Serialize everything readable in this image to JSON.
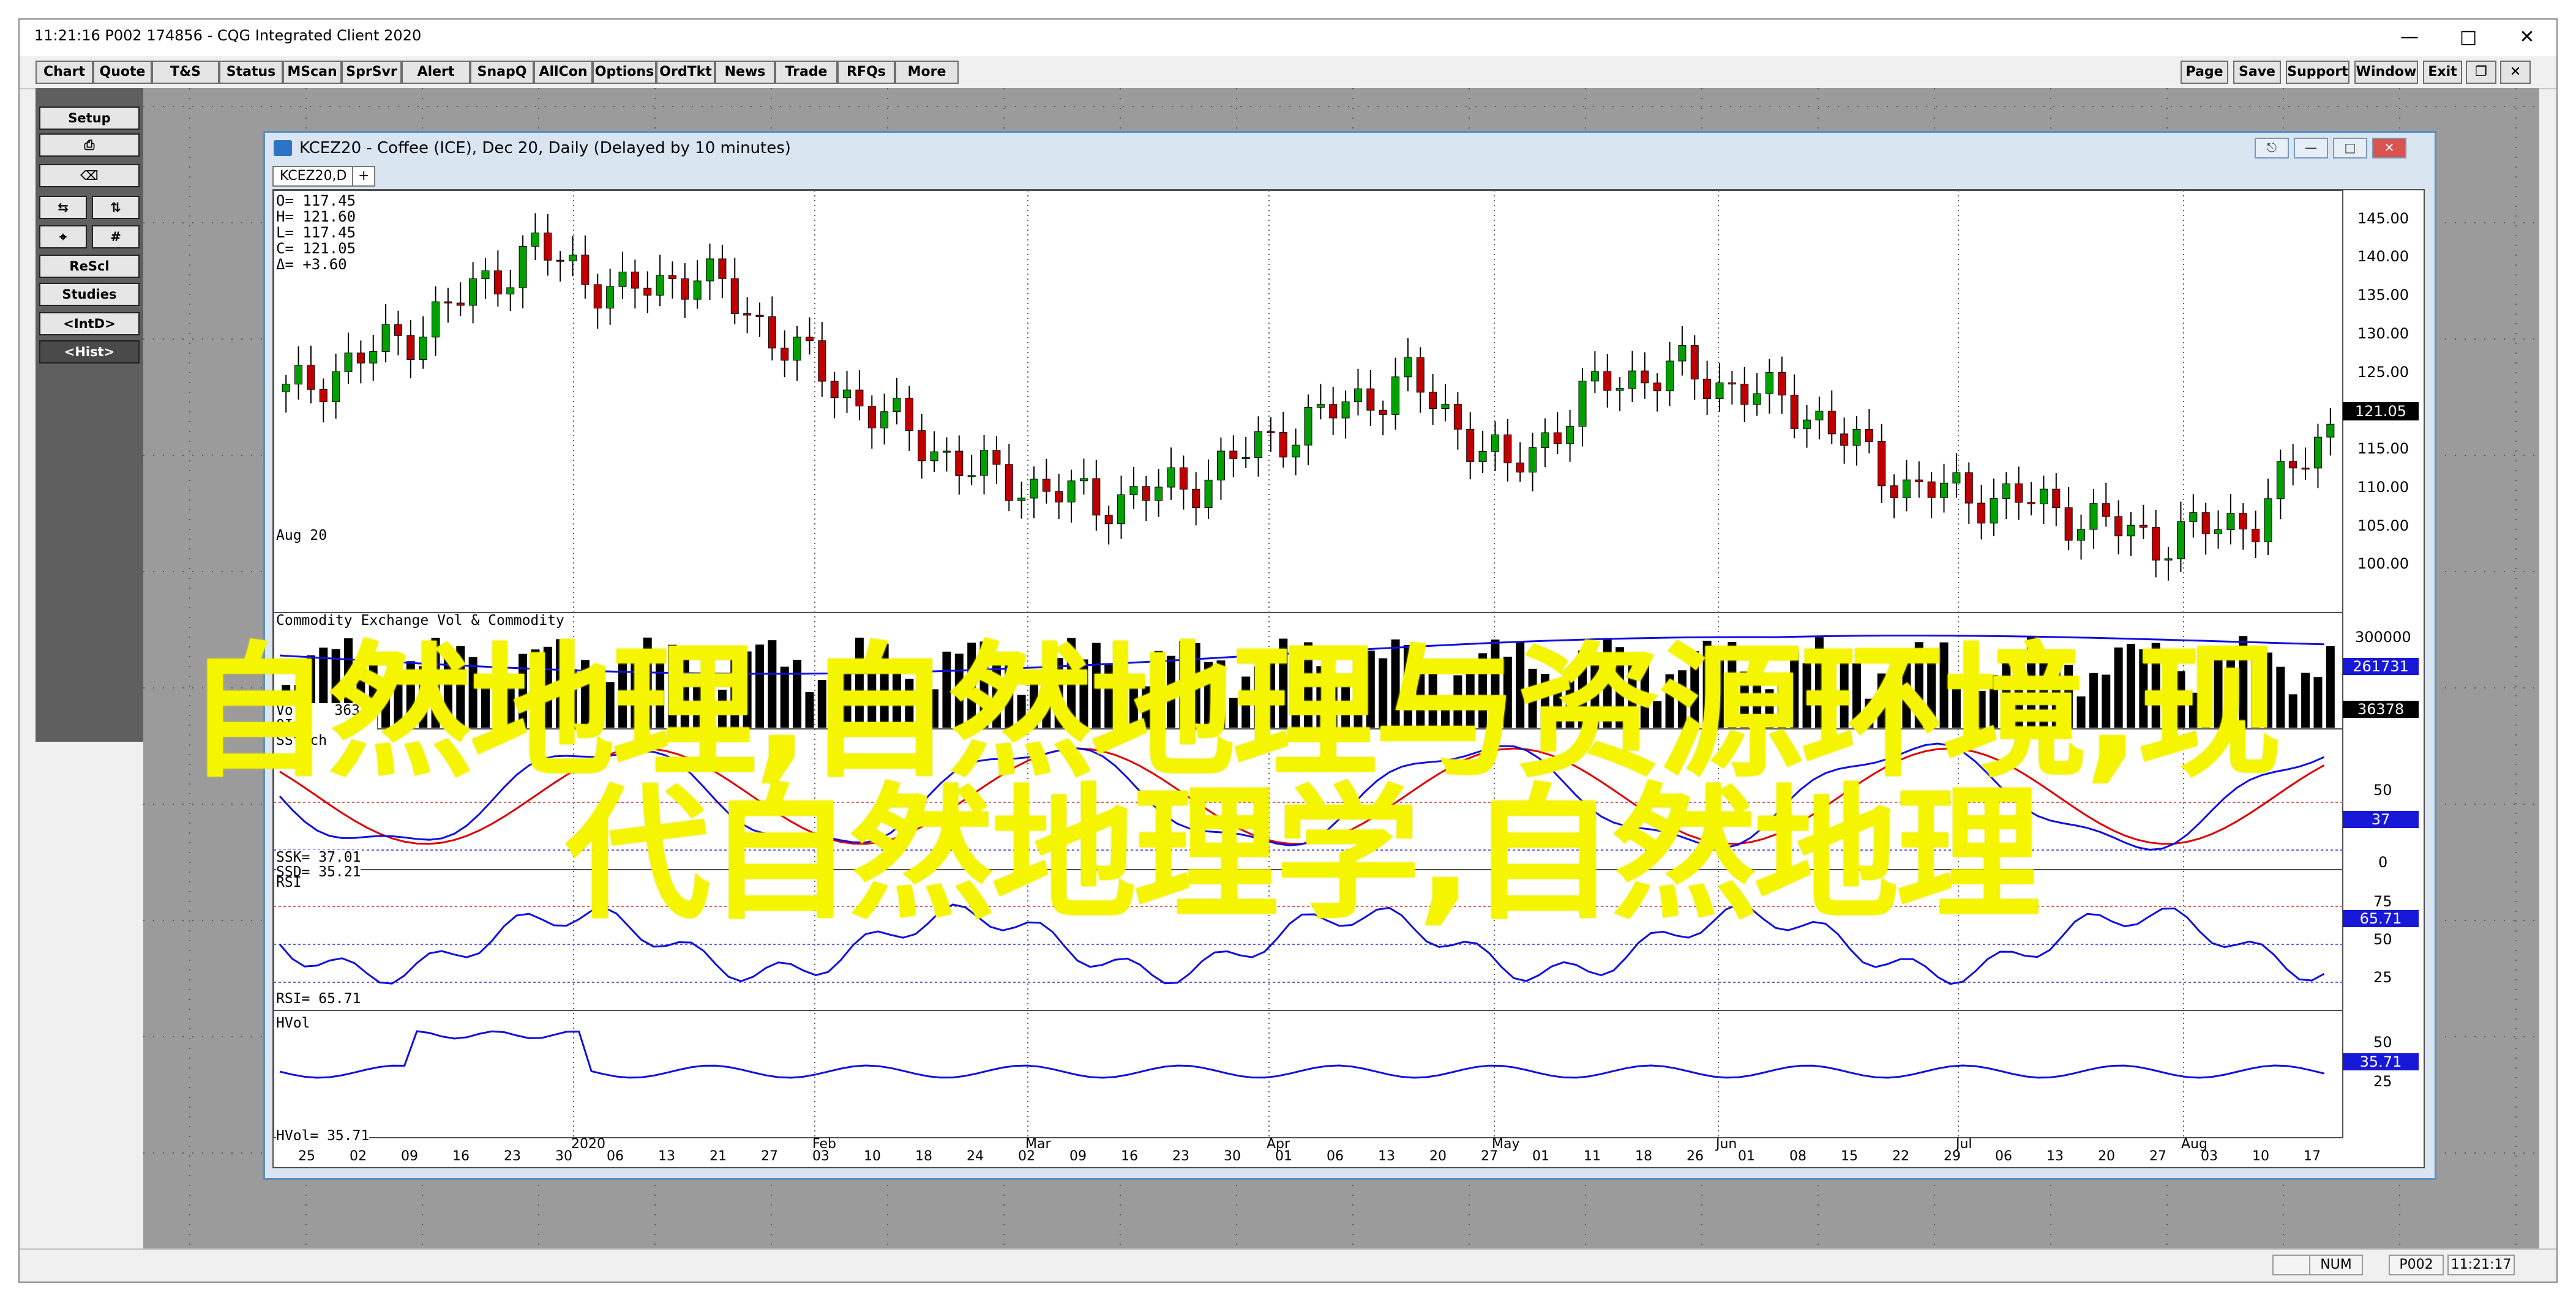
{
  "titlebar": {
    "text": "11:21:16   P002    174856 - CQG Integrated Client 2020",
    "minimize_icon": "minimize-icon",
    "maximize_icon": "maximize-icon",
    "close_icon": "close-icon"
  },
  "toolbar": {
    "left_buttons": [
      "Chart",
      "Quote",
      "T&S",
      "Status",
      "MScan",
      "SprSvr",
      "Alert",
      "SnapQ",
      "AllCon",
      "Options",
      "OrdTkt",
      "News",
      "Trade",
      "RFQs",
      "More"
    ],
    "right_buttons": [
      "Page",
      "Save",
      "Support",
      "Window",
      "Exit"
    ]
  },
  "sidebar": {
    "setup": "Setup",
    "rescl": "ReScl",
    "studies": "Studies",
    "intd": "<IntD>",
    "hist": "<Hist>",
    "print_icon": "printer-icon",
    "cross_icon": "crosshair-icon"
  },
  "chart_window": {
    "title": "KCEZ20 - Coffee (ICE), Dec 20, Daily (Delayed by 10 minutes)",
    "tab_label": "KCEZ20,D",
    "tab_add": "+"
  },
  "quote_box": {
    "o": "O=   117.45",
    "h": "H=   121.60",
    "l": "L=   117.45",
    "c": "C=   121.05",
    "d": "Δ=     +3.60"
  },
  "price_axis": {
    "ticks": [
      "145.00",
      "140.00",
      "135.00",
      "130.00",
      "125.00",
      "120.00",
      "115.00",
      "110.00",
      "105.00",
      "100.00"
    ],
    "last_price": "121.05"
  },
  "volume_panel": {
    "label": "Commodity Exchange Vol & Commodity",
    "vol_label": "Vol=",
    "vol_value": "36378",
    "oi_label": "OI=",
    "ticks": [
      "300000"
    ],
    "oi_badge": "261731",
    "vol_badge": "36378",
    "hidden_value_label": "Aug 20"
  },
  "sstoch_panel": {
    "label": "SStoch",
    "ssk": "SSK=     37.01",
    "ssd": "SSD=     35.21",
    "ticks": [
      "50",
      "0"
    ],
    "badge": "37"
  },
  "rsi_panel": {
    "label": "RSI",
    "value": "RSI=    65.71",
    "ticks": [
      "75",
      "50",
      "25"
    ],
    "badge": "65.71"
  },
  "hvol_panel": {
    "label": "HVol",
    "value": "HVol=    35.71",
    "ticks": [
      "50",
      "25"
    ],
    "badge": "35.71"
  },
  "date_axis": {
    "months": [
      "2020",
      "Feb",
      "Mar",
      "Apr",
      "May",
      "Jun",
      "Jul",
      "Aug"
    ],
    "days": [
      "25",
      "02",
      "09",
      "16",
      "23",
      "30",
      "06",
      "13",
      "21",
      "27",
      "03",
      "10",
      "18",
      "24",
      "02",
      "09",
      "16",
      "23",
      "30",
      "01",
      "06",
      "13",
      "20",
      "27",
      "01",
      "11",
      "18",
      "26",
      "01",
      "08",
      "15",
      "22",
      "29",
      "06",
      "13",
      "20",
      "27",
      "03",
      "10",
      "17"
    ]
  },
  "overlay": {
    "line1": "自然地理,自然地理与资源环境,现",
    "line2": "代自然地理学,自然地理"
  },
  "statusbar": {
    "num": "NUM",
    "page": "P002",
    "time": "11:21:17"
  },
  "colors": {
    "up_candle": "#00a000",
    "down_candle": "#c00000",
    "indicator_blue": "#1010e0",
    "indicator_red": "#e00000",
    "badge_blue": "#1818d8",
    "overlay_yellow": "#f5f500"
  }
}
